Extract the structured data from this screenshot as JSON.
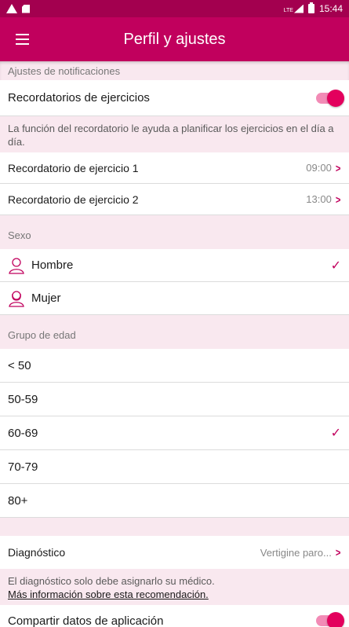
{
  "status_bar": {
    "time": "15:44",
    "network": "LTE"
  },
  "app_bar": {
    "title": "Perfil y ajustes"
  },
  "notifications": {
    "section_label": "Ajustes de notificaciones",
    "reminders_label": "Recordatorios de ejercicios",
    "reminders_on": true,
    "note": "La función del recordatorio le ayuda a planificar los ejercicios en el día a día.",
    "reminders": [
      {
        "label": "Recordatorio de ejercicio 1",
        "time": "09:00"
      },
      {
        "label": "Recordatorio de ejercicio 2",
        "time": "13:00"
      }
    ]
  },
  "sex": {
    "section_label": "Sexo",
    "options": [
      {
        "label": "Hombre",
        "selected": true
      },
      {
        "label": "Mujer",
        "selected": false
      }
    ]
  },
  "age": {
    "section_label": "Grupo de edad",
    "options": [
      {
        "label": "< 50",
        "selected": false
      },
      {
        "label": "50-59",
        "selected": false
      },
      {
        "label": "60-69",
        "selected": true
      },
      {
        "label": "70-79",
        "selected": false
      },
      {
        "label": "80+",
        "selected": false
      }
    ]
  },
  "diagnosis": {
    "label": "Diagnóstico",
    "value": "Vertigine paro...",
    "note": "El diagnóstico solo debe asignarlo su médico.",
    "link": "Más información sobre esta recomendación."
  },
  "share": {
    "label": "Compartir datos de aplicación",
    "on": true
  },
  "colors": {
    "primary": "#c1005d",
    "status_bar": "#a3004f",
    "section_bg": "#f9e8ef"
  }
}
